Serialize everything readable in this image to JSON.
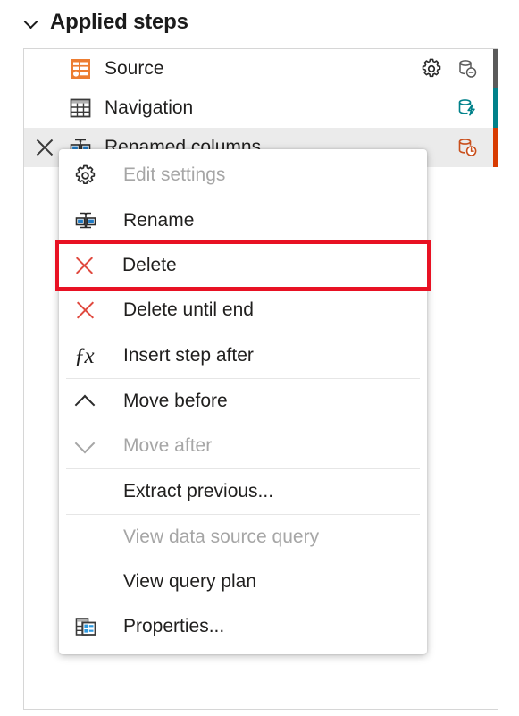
{
  "header": {
    "title": "Applied steps",
    "chevron_icon": "chevron-down-icon",
    "expanded": true
  },
  "colors": {
    "highlight_red": "#e81123",
    "source_icon_orange": "#ed7d31",
    "fold_supported_teal": "#00818a",
    "fold_not_supported_orange": "#c94f1c",
    "fold_unknown_gray": "#5a5a5a",
    "selected_row_bg": "#ebebeb",
    "menu_disabled_text": "#a6a6a6",
    "menu_text": "#201f1e"
  },
  "steps": [
    {
      "label": "Source",
      "icon": "source-step-icon",
      "selected": false,
      "has_gear": true,
      "gear_icon": "gear-icon",
      "fold_icon": "database-unsupported-icon",
      "fold_color": "#5a5a5a",
      "bar_color": "#5a5a5a"
    },
    {
      "label": "Navigation",
      "icon": "table-step-icon",
      "selected": false,
      "has_gear": false,
      "gear_icon": "",
      "fold_icon": "database-folding-icon",
      "fold_color": "#00818a",
      "bar_color": "#00818a"
    },
    {
      "label": "Renamed columns",
      "icon": "rename-columns-step-icon",
      "selected": true,
      "has_gear": false,
      "gear_icon": "",
      "fold_icon": "database-pending-icon",
      "fold_color": "#c94f1c",
      "bar_color": "#d83b01",
      "delete_icon": "close-icon"
    }
  ],
  "context_menu": {
    "highlighted_item": "Delete",
    "groups": [
      {
        "items": [
          {
            "label": "Edit settings",
            "icon": "gear-icon",
            "disabled": true
          }
        ]
      },
      {
        "items": [
          {
            "label": "Rename",
            "icon": "rename-icon",
            "disabled": false
          },
          {
            "label": "Delete",
            "icon": "delete-x-icon",
            "disabled": false,
            "highlighted": true
          },
          {
            "label": "Delete until end",
            "icon": "delete-x-icon",
            "disabled": false
          }
        ]
      },
      {
        "items": [
          {
            "label": "Insert step after",
            "icon": "fx-icon",
            "disabled": false
          }
        ]
      },
      {
        "items": [
          {
            "label": "Move before",
            "icon": "chevron-up-icon",
            "disabled": false
          },
          {
            "label": "Move after",
            "icon": "chevron-down-icon",
            "disabled": true
          }
        ]
      },
      {
        "items": [
          {
            "label": "Extract previous...",
            "icon": "",
            "disabled": false
          }
        ]
      },
      {
        "items": [
          {
            "label": "View data source query",
            "icon": "",
            "disabled": true
          },
          {
            "label": "View query plan",
            "icon": "",
            "disabled": false
          },
          {
            "label": "Properties...",
            "icon": "properties-icon",
            "disabled": false
          }
        ]
      }
    ]
  }
}
